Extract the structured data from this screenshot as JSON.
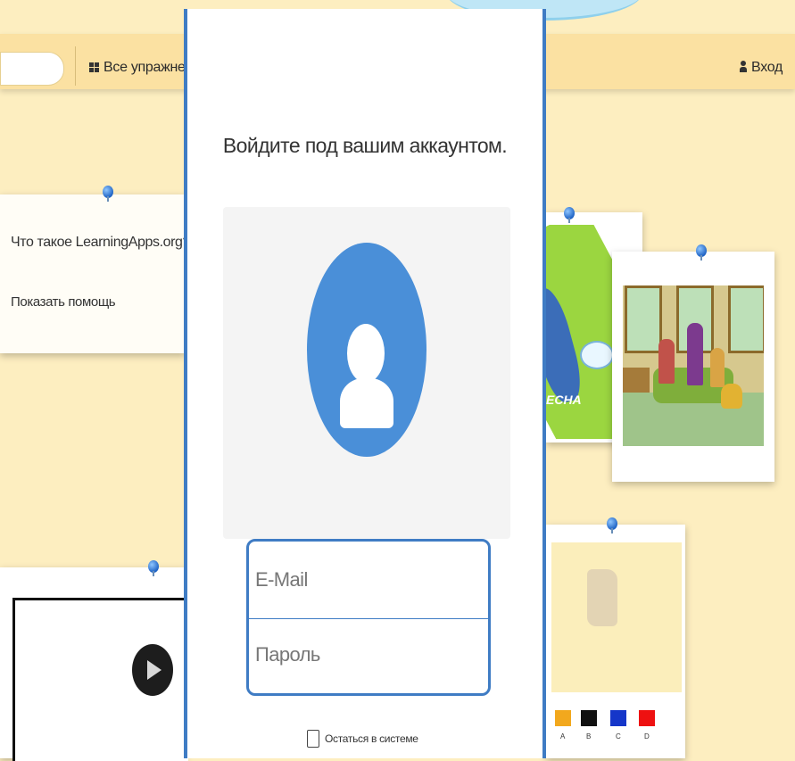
{
  "navbar": {
    "all_exercises_label": "Все упражне",
    "login_label": "Вход"
  },
  "help_card": {
    "title": "Что такое LearningApps.org?",
    "show_help": "Показать помощь"
  },
  "green_card": {
    "caption": "ЕСНА"
  },
  "modal": {
    "title": "Войдите под вашим аккаунтом.",
    "email_placeholder": "E-Mail",
    "password_placeholder": "Пароль",
    "stay_logged_in_label": "Остаться в системе"
  },
  "paint_card": {
    "swatches": [
      {
        "color": "#f2a81d",
        "label": "A"
      },
      {
        "color": "#111111",
        "label": "B"
      },
      {
        "color": "#1536c9",
        "label": "C"
      },
      {
        "color": "#ee1111",
        "label": "D"
      }
    ]
  },
  "colors": {
    "background": "#fdeec0",
    "navbar": "#fbe1a2",
    "accent_blue": "#3f7cc4",
    "avatar_blue": "#4a8fd8"
  },
  "icons": [
    "grid-icon",
    "user-icon",
    "pin-icon",
    "play-icon",
    "avatar-icon"
  ]
}
